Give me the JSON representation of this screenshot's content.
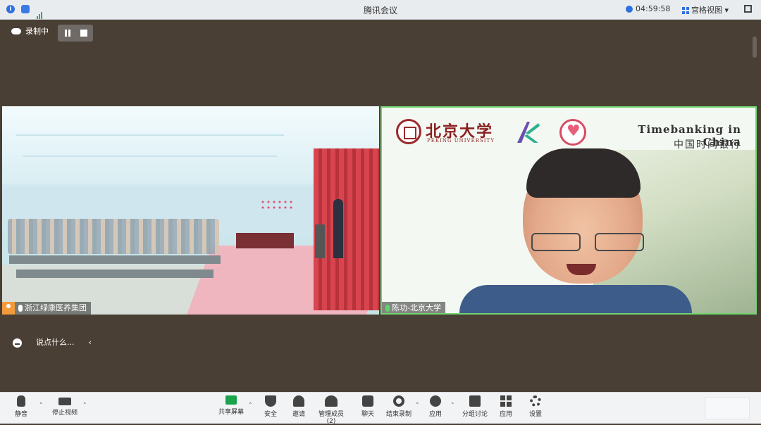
{
  "window": {
    "title": "腾讯会议",
    "time": "04:59:58",
    "view_label": "宫格视图"
  },
  "recording": {
    "label": "录制中"
  },
  "participants": {
    "left": {
      "name": "浙江绿康医养集团"
    },
    "right": {
      "name": "陈功-北京大学"
    }
  },
  "slide": {
    "university_cn": "北京大学",
    "university_en": "PEKING UNIVERSITY",
    "title_en": "Timebanking in China",
    "title_cn": "中国时间银行"
  },
  "chat": {
    "placeholder": "说点什么..."
  },
  "toolbar": {
    "mute": "静音",
    "video": "停止视频",
    "share": "共享屏幕",
    "security": "安全",
    "invite": "邀请",
    "members": "管理成员(2)",
    "chat": "聊天",
    "record": "结束录制",
    "apps_center": "应用",
    "breakout": "分组讨论",
    "apps": "应用",
    "settings": "设置"
  },
  "colors": {
    "active_speaker_border": "#6fd66f",
    "share_green": "#1aa34a",
    "accent_blue": "#2f6fe0"
  }
}
